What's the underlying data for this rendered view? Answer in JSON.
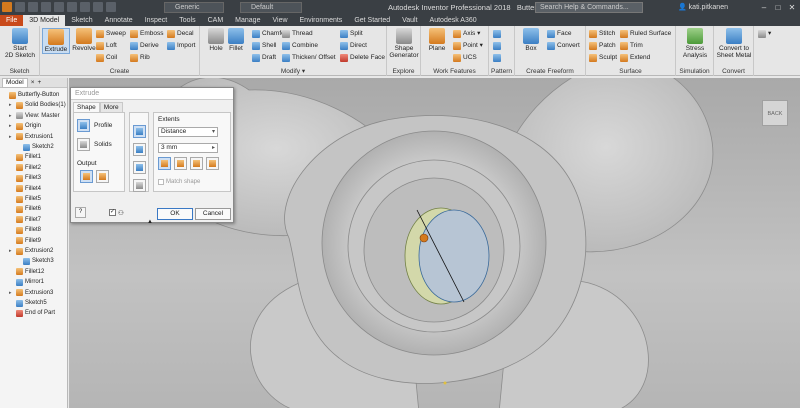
{
  "titlebar": {
    "appearance": "Generic",
    "material": "Default",
    "app_title": "Autodesk Inventor Professional 2018",
    "doc_title": "Butterfly-Button",
    "search_placeholder": "Search Help & Commands...",
    "user": "kati.pitkanen"
  },
  "tabs": [
    {
      "label": "File"
    },
    {
      "label": "3D Model"
    },
    {
      "label": "Sketch"
    },
    {
      "label": "Annotate"
    },
    {
      "label": "Inspect"
    },
    {
      "label": "Tools"
    },
    {
      "label": "CAM"
    },
    {
      "label": "Manage"
    },
    {
      "label": "View"
    },
    {
      "label": "Environments"
    },
    {
      "label": "Get Started"
    },
    {
      "label": "Vault"
    },
    {
      "label": "Autodesk A360"
    }
  ],
  "ribbon": {
    "sketch": {
      "label": "Sketch",
      "start": "Start\n2D Sketch"
    },
    "create": {
      "label": "Create",
      "extrude": "Extrude",
      "revolve": "Revolve",
      "sweep": "Sweep",
      "loft": "Loft",
      "coil": "Coil",
      "emboss": "Emboss",
      "derive": "Derive",
      "rib": "Rib",
      "decal": "Decal",
      "import": "Import"
    },
    "modify": {
      "label": "Modify ▾",
      "hole": "Hole",
      "fillet": "Fillet",
      "chamfer": "Chamfer",
      "shell": "Shell",
      "draft": "Draft",
      "thread": "Thread",
      "combine": "Combine",
      "thicken": "Thicken/ Offset",
      "split": "Split",
      "direct": "Direct",
      "delete_face": "Delete Face"
    },
    "explore": {
      "label": "Explore",
      "shape_gen": "Shape\nGenerator"
    },
    "work": {
      "label": "Work Features",
      "plane": "Plane",
      "axis": "Axis ▾",
      "point": "Point ▾",
      "ucs": "UCS"
    },
    "pattern": {
      "label": "Pattern"
    },
    "freeform": {
      "label": "Create Freeform",
      "box": "Box",
      "face": "Face",
      "convert": "Convert"
    },
    "surface": {
      "label": "Surface",
      "stitch": "Stitch",
      "patch": "Patch",
      "sculpt": "Sculpt",
      "ruled": "Ruled Surface",
      "trim": "Trim",
      "extend": "Extend"
    },
    "simulation": {
      "label": "Simulation",
      "stress": "Stress\nAnalysis"
    },
    "convert": {
      "label": "Convert",
      "sheet": "Convert to\nSheet Metal"
    }
  },
  "browser": {
    "tab": "Model",
    "items": [
      {
        "label": "Butterfly-Button",
        "indent": 0,
        "icon": "part-icon"
      },
      {
        "label": "Solid Bodies(1)",
        "indent": 1,
        "icon": "folder-icon"
      },
      {
        "label": "View: Master",
        "indent": 1,
        "icon": "view-icon"
      },
      {
        "label": "Origin",
        "indent": 1,
        "icon": "folder-icon"
      },
      {
        "label": "Extrusion1",
        "indent": 1,
        "icon": "extrude-icon"
      },
      {
        "label": "Sketch2",
        "indent": 2,
        "icon": "sketch-icon"
      },
      {
        "label": "Fillet1",
        "indent": 1,
        "icon": "fillet-icon"
      },
      {
        "label": "Fillet2",
        "indent": 1,
        "icon": "fillet-icon"
      },
      {
        "label": "Fillet3",
        "indent": 1,
        "icon": "fillet-icon"
      },
      {
        "label": "Fillet4",
        "indent": 1,
        "icon": "fillet-icon"
      },
      {
        "label": "Fillet5",
        "indent": 1,
        "icon": "fillet-icon"
      },
      {
        "label": "Fillet6",
        "indent": 1,
        "icon": "fillet-icon"
      },
      {
        "label": "Fillet7",
        "indent": 1,
        "icon": "fillet-icon"
      },
      {
        "label": "Fillet8",
        "indent": 1,
        "icon": "fillet-icon"
      },
      {
        "label": "Fillet9",
        "indent": 1,
        "icon": "fillet-icon"
      },
      {
        "label": "Extrusion2",
        "indent": 1,
        "icon": "extrude-icon"
      },
      {
        "label": "Sketch3",
        "indent": 2,
        "icon": "sketch-icon"
      },
      {
        "label": "Fillet12",
        "indent": 1,
        "icon": "fillet-icon"
      },
      {
        "label": "Mirror1",
        "indent": 1,
        "icon": "mirror-icon"
      },
      {
        "label": "Extrusion3",
        "indent": 1,
        "icon": "extrude-icon"
      },
      {
        "label": "Sketch5",
        "indent": 1,
        "icon": "sketch-icon"
      },
      {
        "label": "End of Part",
        "indent": 1,
        "icon": "end-icon"
      }
    ]
  },
  "dialog": {
    "title": "Extrude",
    "tabs": [
      "Shape",
      "More"
    ],
    "profile": "Profile",
    "solids": "Solids",
    "output": "Output",
    "extents": "Extents",
    "extents_type": "Distance",
    "distance": "3 mm",
    "match_shape": "Match shape",
    "ok": "OK",
    "cancel": "Cancel",
    "help": "?"
  },
  "viewcube": {
    "label": "BACK"
  },
  "colors": {
    "accent": "#3b7fc4",
    "file_tab": "#c94a1a",
    "titlebar": "#3a3f44"
  }
}
